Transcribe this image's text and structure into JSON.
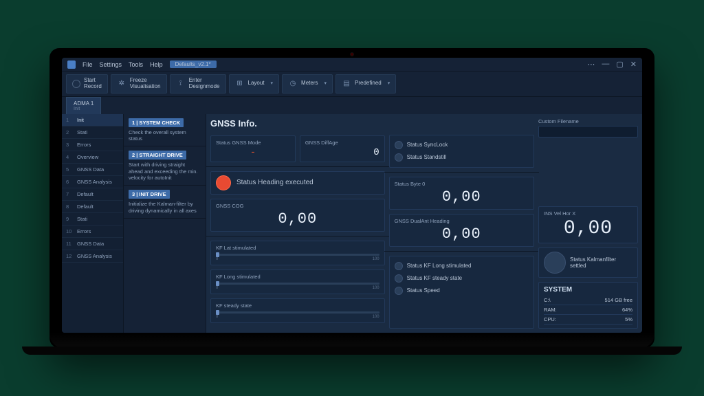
{
  "menu": {
    "file": "File",
    "settings": "Settings",
    "tools": "Tools",
    "help": "Help",
    "config": "Defaults_v2.1*"
  },
  "toolbar": {
    "record": "Start\nRecord",
    "freeze": "Freeze\nVisualisation",
    "design": "Enter\nDesignmode",
    "layout": "Layout",
    "meters": "Meters",
    "predefined": "Predefined"
  },
  "device_tab": {
    "name": "ADMA 1",
    "state": "Init"
  },
  "sidenav": [
    {
      "n": "1",
      "label": "Init",
      "active": true
    },
    {
      "n": "2",
      "label": "Stati"
    },
    {
      "n": "3",
      "label": "Errors"
    },
    {
      "n": "4",
      "label": "Overview"
    },
    {
      "n": "5",
      "label": "GNSS Data"
    },
    {
      "n": "6",
      "label": "GNSS Analysis"
    },
    {
      "n": "7",
      "label": "Default"
    },
    {
      "n": "8",
      "label": "Default"
    },
    {
      "n": "9",
      "label": "Stati"
    },
    {
      "n": "10",
      "label": "Errors"
    },
    {
      "n": "11",
      "label": "GNSS Data"
    },
    {
      "n": "12",
      "label": "GNSS Analysis"
    }
  ],
  "steps": [
    {
      "title": "1 | SYSTEM CHECK",
      "desc": "Check the overall system status"
    },
    {
      "title": "2 | STRAIGHT DRIVE",
      "desc": "Start with driving straight ahead and exceeding the min. velocity for autoInit"
    },
    {
      "title": "3 | INIT DRIVE",
      "desc": "Initialize the Kalman-filter by driving dynamically in all axes"
    }
  ],
  "section_title": "GNSS Info.",
  "gnss_mode": {
    "label": "Status GNSS Mode",
    "value": "-"
  },
  "diff_age": {
    "label": "GNSS DiffAge",
    "value": "0"
  },
  "sync": {
    "label": "Status SyncLock"
  },
  "standstill": {
    "label": "Status Standstill"
  },
  "heading_status": "Status Heading executed",
  "byte0": {
    "label": "Status Byte 0",
    "value": "0,00"
  },
  "gnss_cog": {
    "label": "GNSS COG",
    "value": "0,00"
  },
  "dual_ant": {
    "label": "GNSS DualAnt Heading",
    "value": "0,00"
  },
  "ins_vel": {
    "label": "INS Vel Hor X",
    "value": "0,00"
  },
  "kf_lat": {
    "label": "KF Lat stimulated",
    "min": "0",
    "max": "100"
  },
  "kf_long": {
    "label": "KF Long stimulated",
    "min": "0",
    "max": "100"
  },
  "kf_steady": {
    "label": "KF steady state",
    "min": "0",
    "max": "100"
  },
  "statuses": {
    "kf_long_stim": "Status KF Long stimulated",
    "kf_steady": "Status KF steady state",
    "speed": "Status Speed"
  },
  "kalman": "Status Kalmanfilter settled",
  "custom_filename": {
    "label": "Custom Filename",
    "value": ""
  },
  "system": {
    "title": "SYSTEM",
    "disk_label": "C:\\",
    "disk_value": "514 GB free",
    "ram_label": "RAM:",
    "ram_value": "64%",
    "cpu_label": "CPU:",
    "cpu_value": "5%"
  }
}
